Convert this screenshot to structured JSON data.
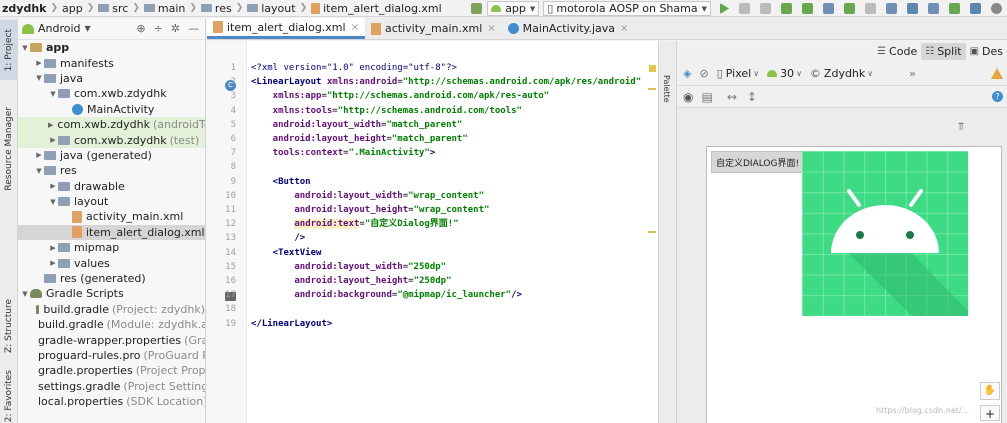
{
  "breadcrumbs": [
    "zdydhk",
    "app",
    "src",
    "main",
    "res",
    "layout",
    "item_alert_dialog.xml"
  ],
  "toolbar": {
    "run_config": "app",
    "device": "motorola AOSP on Shama"
  },
  "side_tabs": {
    "project": "1: Project",
    "resource_manager": "Resource Manager",
    "structure": "Z: Structure",
    "favorites": "2: Favorites"
  },
  "project_panel": {
    "view_mode": "Android"
  },
  "tree": [
    {
      "label": "app",
      "grey": "",
      "indent": 0,
      "arrow": "down",
      "icon": "folder-yellow",
      "bold": true
    },
    {
      "label": "manifests",
      "grey": "",
      "indent": 1,
      "arrow": "right",
      "icon": "folder"
    },
    {
      "label": "java",
      "grey": "",
      "indent": 1,
      "arrow": "down",
      "icon": "folder"
    },
    {
      "label": "com.xwb.zdydhk",
      "grey": "",
      "indent": 2,
      "arrow": "down",
      "icon": "folder"
    },
    {
      "label": "MainActivity",
      "grey": "",
      "indent": 3,
      "arrow": "",
      "icon": "class"
    },
    {
      "label": "com.xwb.zdydhk",
      "grey": "(androidTest)",
      "indent": 2,
      "arrow": "right",
      "icon": "folder",
      "hl": true
    },
    {
      "label": "com.xwb.zdydhk",
      "grey": "(test)",
      "indent": 2,
      "arrow": "right",
      "icon": "folder",
      "hl": true
    },
    {
      "label": "java (generated)",
      "grey": "",
      "indent": 1,
      "arrow": "right",
      "icon": "folder"
    },
    {
      "label": "res",
      "grey": "",
      "indent": 1,
      "arrow": "down",
      "icon": "folder"
    },
    {
      "label": "drawable",
      "grey": "",
      "indent": 2,
      "arrow": "right",
      "icon": "folder"
    },
    {
      "label": "layout",
      "grey": "",
      "indent": 2,
      "arrow": "down",
      "icon": "folder"
    },
    {
      "label": "activity_main.xml",
      "grey": "",
      "indent": 3,
      "arrow": "",
      "icon": "xml"
    },
    {
      "label": "item_alert_dialog.xml",
      "grey": "",
      "indent": 3,
      "arrow": "",
      "icon": "xml",
      "sel": true
    },
    {
      "label": "mipmap",
      "grey": "",
      "indent": 2,
      "arrow": "right",
      "icon": "folder"
    },
    {
      "label": "values",
      "grey": "",
      "indent": 2,
      "arrow": "right",
      "icon": "folder"
    },
    {
      "label": "res (generated)",
      "grey": "",
      "indent": 1,
      "arrow": "",
      "icon": "folder"
    },
    {
      "label": "Gradle Scripts",
      "grey": "",
      "indent": 0,
      "arrow": "down",
      "icon": "gradle"
    },
    {
      "label": "build.gradle",
      "grey": "(Project: zdydhk)",
      "indent": 1,
      "arrow": "",
      "icon": "gradle"
    },
    {
      "label": "build.gradle",
      "grey": "(Module: zdydhk.app)",
      "indent": 1,
      "arrow": "",
      "icon": "gradle"
    },
    {
      "label": "gradle-wrapper.properties",
      "grey": "(Gradle Version)",
      "indent": 1,
      "arrow": "",
      "icon": "prop"
    },
    {
      "label": "proguard-rules.pro",
      "grey": "(ProGuard Rules)",
      "indent": 1,
      "arrow": "",
      "icon": "prop"
    },
    {
      "label": "gradle.properties",
      "grey": "(Project Properties)",
      "indent": 1,
      "arrow": "",
      "icon": "prop"
    },
    {
      "label": "settings.gradle",
      "grey": "(Project Settings)",
      "indent": 1,
      "arrow": "",
      "icon": "gradle"
    },
    {
      "label": "local.properties",
      "grey": "(SDK Location)",
      "indent": 1,
      "arrow": "",
      "icon": "prop"
    }
  ],
  "tabs": [
    {
      "label": "item_alert_dialog.xml",
      "icon": "xml",
      "active": true
    },
    {
      "label": "activity_main.xml",
      "icon": "xml",
      "active": false
    },
    {
      "label": "MainActivity.java",
      "icon": "class",
      "active": false
    }
  ],
  "editor": {
    "line_numbers": [
      "1",
      "2",
      "3",
      "4",
      "5",
      "6",
      "7",
      "8",
      "9",
      "10",
      "11",
      "12",
      "13",
      "14",
      "15",
      "16",
      "17",
      "18",
      "19"
    ],
    "lines": [
      [
        {
          "t": "<?xml version=\"1.0\" encoding=\"utf-8\"?>",
          "c": "pi"
        }
      ],
      [
        {
          "t": "<LinearLayout ",
          "c": "tag"
        },
        {
          "t": "xmlns:android",
          "c": "attr"
        },
        {
          "t": "=",
          "c": "plain"
        },
        {
          "t": "\"http://schemas.android.com/apk/res/android\"",
          "c": "val"
        }
      ],
      [
        {
          "t": "    xmlns:app",
          "c": "attr"
        },
        {
          "t": "=",
          "c": "plain"
        },
        {
          "t": "\"http://schemas.android.com/apk/res-auto\"",
          "c": "val"
        }
      ],
      [
        {
          "t": "    xmlns:tools",
          "c": "attr"
        },
        {
          "t": "=",
          "c": "plain"
        },
        {
          "t": "\"http://schemas.android.com/tools\"",
          "c": "val"
        }
      ],
      [
        {
          "t": "    android:layout_width",
          "c": "attr"
        },
        {
          "t": "=",
          "c": "plain"
        },
        {
          "t": "\"match_parent\"",
          "c": "val"
        }
      ],
      [
        {
          "t": "    android:layout_height",
          "c": "attr"
        },
        {
          "t": "=",
          "c": "plain"
        },
        {
          "t": "\"match_parent\"",
          "c": "val"
        }
      ],
      [
        {
          "t": "    tools:context",
          "c": "attr"
        },
        {
          "t": "=",
          "c": "plain"
        },
        {
          "t": "\".MainActivity\"",
          "c": "val"
        },
        {
          "t": ">",
          "c": "tag"
        }
      ],
      [],
      [
        {
          "t": "    <Button",
          "c": "tag"
        }
      ],
      [
        {
          "t": "        android:layout_width",
          "c": "attr"
        },
        {
          "t": "=",
          "c": "plain"
        },
        {
          "t": "\"wrap_content\"",
          "c": "val"
        }
      ],
      [
        {
          "t": "        android:layout_height",
          "c": "attr"
        },
        {
          "t": "=",
          "c": "plain"
        },
        {
          "t": "\"wrap_content\"",
          "c": "val"
        }
      ],
      [
        {
          "t": "        ",
          "c": "plain"
        },
        {
          "t": "android:text",
          "c": "attr",
          "hl": true
        },
        {
          "t": "=",
          "c": "plain"
        },
        {
          "t": "\"自定义Dialog界面!\"",
          "c": "val"
        }
      ],
      [
        {
          "t": "        />",
          "c": "tag"
        }
      ],
      [
        {
          "t": "    <TextView",
          "c": "tag"
        }
      ],
      [
        {
          "t": "        android:layout_width",
          "c": "attr"
        },
        {
          "t": "=",
          "c": "plain"
        },
        {
          "t": "\"250dp\"",
          "c": "val"
        }
      ],
      [
        {
          "t": "        android:layout_height",
          "c": "attr"
        },
        {
          "t": "=",
          "c": "plain"
        },
        {
          "t": "\"250dp\"",
          "c": "val"
        }
      ],
      [
        {
          "t": "        android:background",
          "c": "attr"
        },
        {
          "t": "=",
          "c": "plain"
        },
        {
          "t": "\"@mipmap/ic_launcher\"",
          "c": "val"
        },
        {
          "t": "/>",
          "c": "tag"
        }
      ],
      [],
      [
        {
          "t": "</LinearLayout>",
          "c": "tag"
        }
      ]
    ]
  },
  "design": {
    "palette_label": "Palette",
    "modes": [
      "Code",
      "Split",
      "Des"
    ],
    "active_mode": "Split",
    "device": "Pixel",
    "api": "30",
    "theme": "Zdydhk",
    "preview_button_text": "自定义DIALOG界面!"
  },
  "watermark": "https://blog.csdn.net/..."
}
